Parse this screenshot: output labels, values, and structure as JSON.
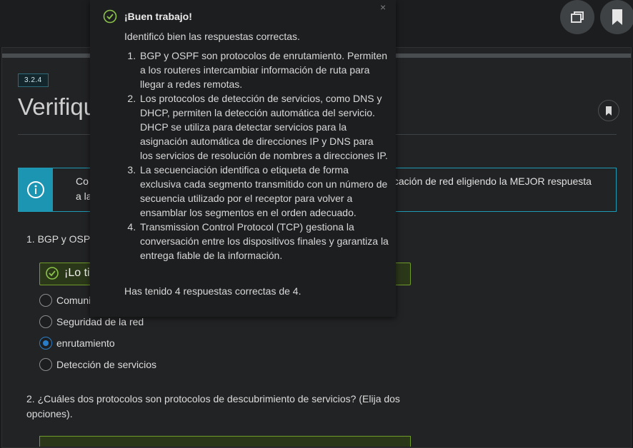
{
  "header": {
    "window_button_icon": "window-restore-icon",
    "bookmark_icon": "bookmark-icon"
  },
  "page": {
    "badge": "3.2.4",
    "title": "Verifique"
  },
  "info": {
    "line1_left": "Co",
    "line1_right": "nicación de red eligiendo la MEJOR respuesta",
    "line2_left": "a la"
  },
  "question1": {
    "text": "1. BGP y OSP",
    "feedback": "¡Lo ti",
    "options": [
      "Comuni",
      "Seguridad de la red",
      "enrutamiento",
      "Detección de servicios"
    ],
    "selected": "enrutamiento"
  },
  "question2": {
    "text": "2. ¿Cuáles dos protocolos son protocolos de descubrimiento de servicios? (Elija dos opciones)."
  },
  "popup": {
    "close": "×",
    "title": "¡Buen trabajo!",
    "intro": "Identificó bien las respuestas correctas.",
    "items": [
      "BGP y OSPF son protocolos de enrutamiento. Permiten a los routeres intercambiar información de ruta para llegar a redes remotas.",
      "Los protocolos de detección de servicios, como DNS y DHCP, permiten la detección automática del servicio. DHCP se utiliza para detectar servicios para la asignación automática de direcciones IP y DNS para los servicios de resolución de nombres a direcciones IP.",
      "La secuenciación identifica o etiqueta de forma exclusiva cada segmento transmitido con un número de secuencia utilizado por el receptor para volver a ensamblar los segmentos en el orden adecuado.",
      "Transmission Control Protocol (TCP) gestiona la conversación entre los dispositivos finales y garantiza la entrega fiable de la información."
    ],
    "footer": "Has tenido 4 respuestas correctas de 4."
  },
  "colors": {
    "accent": "#1c95b3",
    "success": "#6f9b2a",
    "radio_selected": "#2a7ec9"
  }
}
